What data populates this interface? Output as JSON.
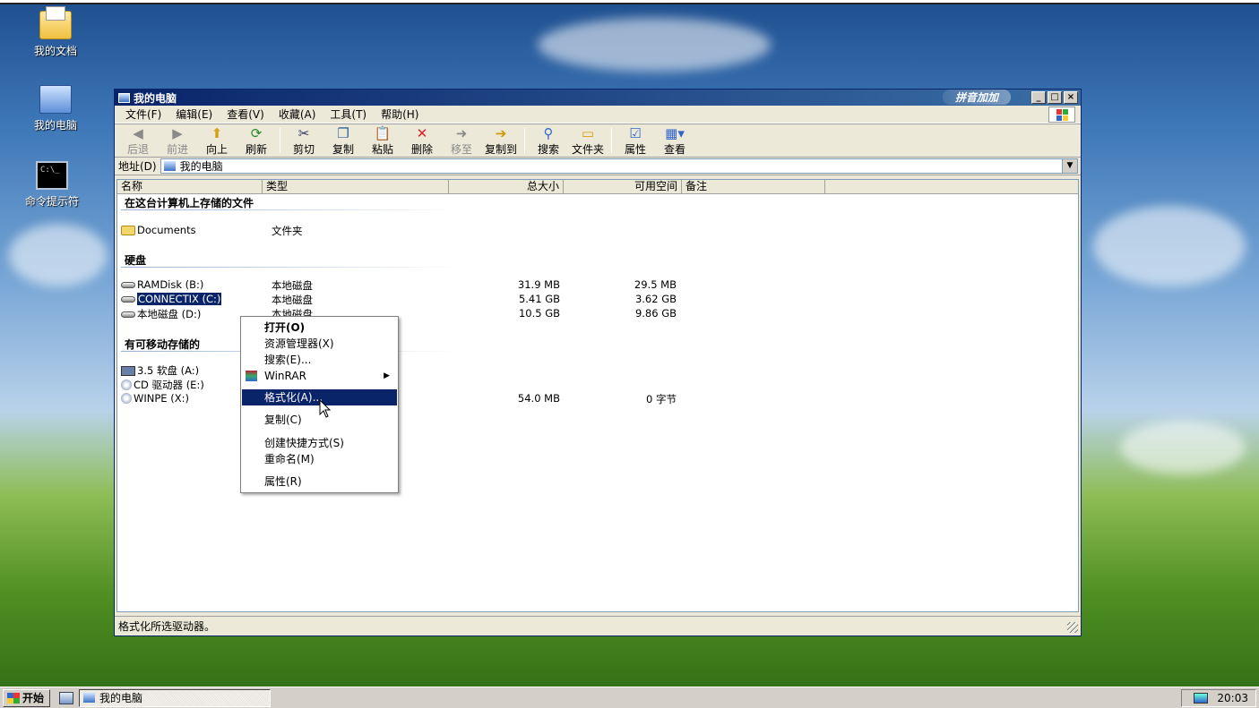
{
  "desktop": {
    "icons": [
      {
        "label": "我的文档",
        "icon": "documents-folder-icon"
      },
      {
        "label": "我的电脑",
        "icon": "my-computer-icon"
      },
      {
        "label": "命令提示符",
        "icon": "command-prompt-icon"
      }
    ]
  },
  "window": {
    "title": "我的电脑",
    "ime_badge": "拼音加加",
    "controls": {
      "minimize": "_",
      "maximize": "□",
      "close": "×"
    },
    "menu": [
      "文件(F)",
      "编辑(E)",
      "查看(V)",
      "收藏(A)",
      "工具(T)",
      "帮助(H)"
    ],
    "toolbar": [
      {
        "label": "后退",
        "icon": "back-icon",
        "enabled": false
      },
      {
        "label": "前进",
        "icon": "forward-icon",
        "enabled": false
      },
      {
        "label": "向上",
        "icon": "up-icon",
        "enabled": true
      },
      {
        "label": "刷新",
        "icon": "refresh-icon",
        "enabled": true
      },
      {
        "label": "剪切",
        "icon": "cut-icon",
        "enabled": true
      },
      {
        "label": "复制",
        "icon": "copy-icon",
        "enabled": true
      },
      {
        "label": "粘贴",
        "icon": "paste-icon",
        "enabled": true
      },
      {
        "label": "删除",
        "icon": "delete-icon",
        "enabled": true
      },
      {
        "label": "移至",
        "icon": "move-to-icon",
        "enabled": false
      },
      {
        "label": "复制到",
        "icon": "copy-to-icon",
        "enabled": true
      },
      {
        "label": "搜索",
        "icon": "search-icon",
        "enabled": true
      },
      {
        "label": "文件夹",
        "icon": "folders-icon",
        "enabled": true
      },
      {
        "label": "属性",
        "icon": "properties-icon",
        "enabled": true
      },
      {
        "label": "查看",
        "icon": "views-icon",
        "enabled": true
      }
    ],
    "address": {
      "label": "地址(D)",
      "value": "我的电脑"
    },
    "columns": [
      "名称",
      "类型",
      "总大小",
      "可用空间",
      "备注"
    ],
    "groups": {
      "stored_files": "在这台计算机上存储的文件",
      "hard_disks": "硬盘",
      "removable": "有可移动存储的"
    },
    "items": [
      {
        "name": "Documents",
        "type": "文件夹",
        "total": "",
        "free": "",
        "icon": "folder-icon"
      },
      {
        "name": "RAMDisk (B:)",
        "type": "本地磁盘",
        "total": "31.9 MB",
        "free": "29.5 MB",
        "icon": "drive-icon"
      },
      {
        "name": "CONNECTIX (C:)",
        "type": "本地磁盘",
        "total": "5.41 GB",
        "free": "3.62 GB",
        "icon": "drive-icon",
        "selected": true
      },
      {
        "name": "本地磁盘 (D:)",
        "type": "本地磁盘",
        "total": "10.5 GB",
        "free": "9.86 GB",
        "icon": "drive-icon"
      },
      {
        "name": "3.5 软盘 (A:)",
        "type": "",
        "total": "",
        "free": "",
        "icon": "floppy-icon"
      },
      {
        "name": "CD 驱动器 (E:)",
        "type": "",
        "total": "",
        "free": "",
        "icon": "cd-drive-icon"
      },
      {
        "name": "WINPE (X:)",
        "type": "",
        "total": "54.0 MB",
        "free": "0 字节",
        "icon": "cd-drive-icon"
      }
    ],
    "status": "格式化所选驱动器。"
  },
  "context_menu": {
    "items": [
      {
        "label": "打开(O)",
        "bold": true
      },
      {
        "label": "资源管理器(X)"
      },
      {
        "label": "搜索(E)..."
      },
      {
        "label": "WinRAR",
        "submenu": true
      },
      {
        "label": "格式化(A)...",
        "highlighted": true
      },
      {
        "label": "复制(C)"
      },
      {
        "label": "创建快捷方式(S)"
      },
      {
        "label": "重命名(M)"
      },
      {
        "label": "属性(R)"
      }
    ]
  },
  "taskbar": {
    "start": "开始",
    "task": "我的电脑",
    "clock": "20:03"
  }
}
